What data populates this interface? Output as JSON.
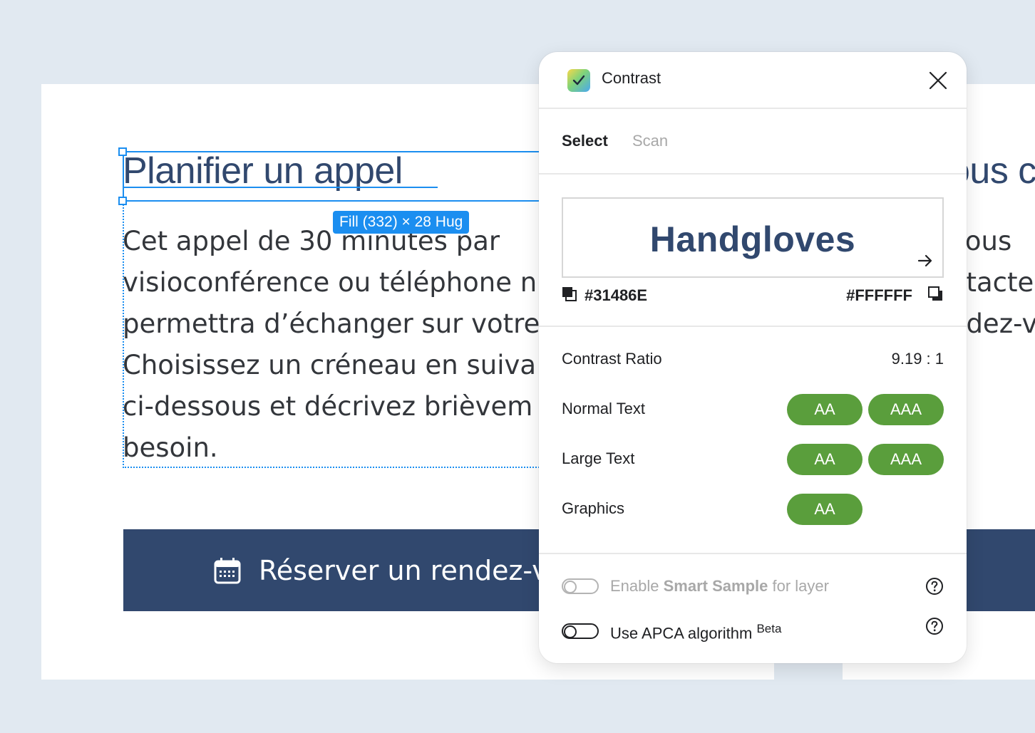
{
  "canvas": {
    "left_card": {
      "heading": "Planifier un appel",
      "paragraph_lines": [
        "Cet appel de 30 minutes par",
        "visioconférence ou téléphone n",
        "permettra d’échanger sur votre",
        "Choisissez un créneau en suiva",
        "ci-dessous et décrivez brièvem",
        "besoin."
      ],
      "cta_label": "Réserver un rendez-vous",
      "cta_icon": "calendar-icon"
    },
    "right_card": {
      "heading": "ous c",
      "paragraph_lines": [
        "vous",
        "ntacte",
        "ndez-v"
      ]
    },
    "selection_badge": "Fill (332) × 28 Hug"
  },
  "panel": {
    "title": "Contrast",
    "app_icon": "checkmark-icon",
    "tabs": [
      {
        "label": "Select",
        "active": true
      },
      {
        "label": "Scan",
        "active": false
      }
    ],
    "preview_text": "Handgloves",
    "foreground_hex": "#31486E",
    "background_hex": "#FFFFFF",
    "contrast_ratio_label": "Contrast Ratio",
    "contrast_ratio_value": "9.19 : 1",
    "rows": [
      {
        "label": "Normal Text",
        "badges": [
          "AA",
          "AAA"
        ]
      },
      {
        "label": "Large Text",
        "badges": [
          "AA",
          "AAA"
        ]
      },
      {
        "label": "Graphics",
        "badges": [
          "AA"
        ]
      }
    ],
    "options": {
      "smart_sample": {
        "prefix": "Enable ",
        "bold": "Smart Sample",
        "suffix": " for layer",
        "enabled": false,
        "disabled": true
      },
      "apca": {
        "label": "Use APCA algorithm ",
        "sup": "Beta",
        "enabled": false
      }
    }
  },
  "colors": {
    "page_bg": "#e1e9f1",
    "brand_navy": "#31486e",
    "pass_green": "#5a9e3c",
    "selection_blue": "#1b8ef0"
  }
}
